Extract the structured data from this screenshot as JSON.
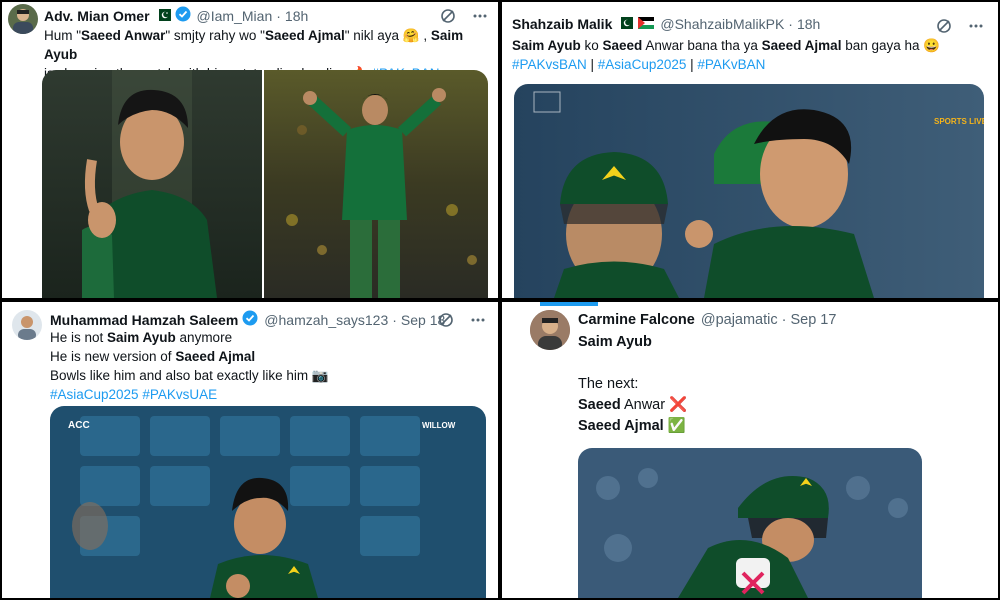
{
  "tweets": [
    {
      "author": "Adv. Mian Omer",
      "handle": "@Iam_Mian",
      "time": "18h",
      "text_parts": [
        "Hum \"",
        "Saeed Anwar",
        "\" smjty rahy wo \"",
        "Saeed Ajmal",
        "\" nikl aya 🤗 , ",
        "Saim Ayub"
      ],
      "text_line2": "is changing the match with his outstanding bowling 🔥 ",
      "hashtag": "#PAKvBAN"
    },
    {
      "author": "Shahzaib Malik",
      "handle": "@ShahzaibMalikPK",
      "time": "18h",
      "text_parts": [
        "Saim Ayub",
        " ko ",
        "Saeed",
        " Anwar bana tha ya ",
        "Saeed Ajmal",
        " ban gaya ha 😀"
      ],
      "hashtags": [
        "#PAKvsBAN",
        " | ",
        "#AsiaCup2025",
        " | ",
        "#PAKvBAN"
      ],
      "overlay_logo": "SPORTS LIVE"
    },
    {
      "author": "Muhammad Hamzah Saleem",
      "handle": "@hamzah_says123",
      "time": "Sep 18",
      "lines": [
        "He is not ",
        "Saim Ayub",
        " anymore"
      ],
      "line2": [
        "He is new version of ",
        "Saeed Ajmal"
      ],
      "line3": "Bowls like him and also bat exactly like him 📷",
      "hashtags": [
        "#AsiaCup2025",
        " ",
        "#PAKvsUAE"
      ],
      "overlay_left": "ACC",
      "overlay_right": "WILLOW"
    },
    {
      "author": "Carmine Falcone",
      "handle": "@pajamatic",
      "time": "Sep 17",
      "line1": "Saim Ayub",
      "line2": "The next:",
      "line3": [
        "Saeed",
        " Anwar ❌"
      ],
      "line4": [
        "Saeed Ajmal",
        " ✅"
      ]
    }
  ]
}
